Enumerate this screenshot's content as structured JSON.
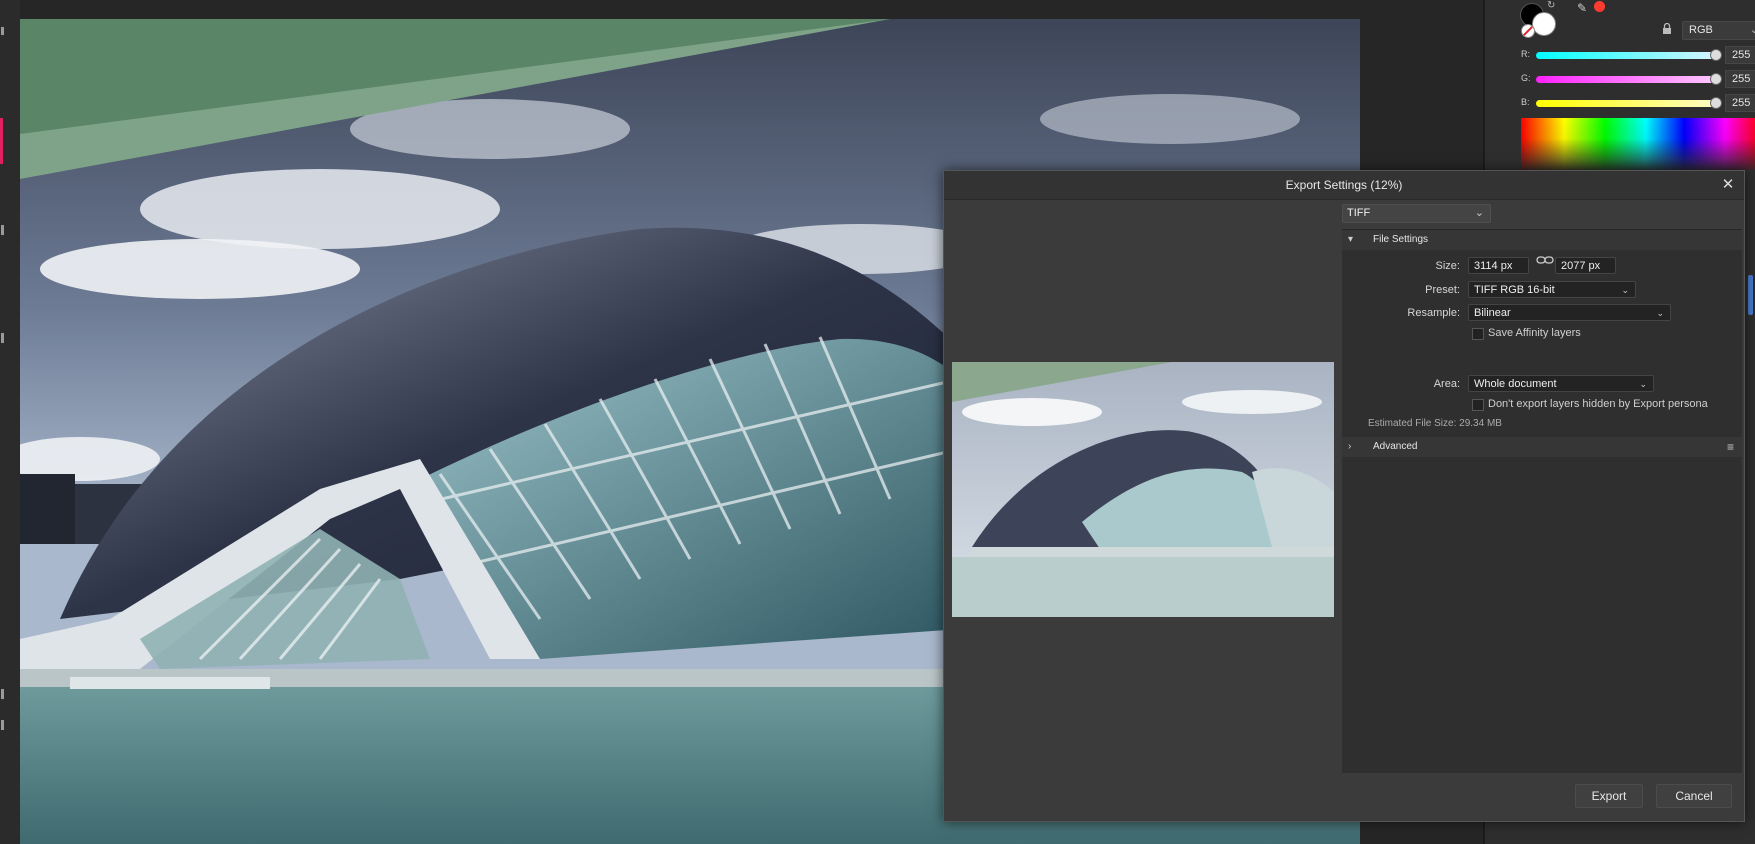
{
  "dialog": {
    "title": "Export Settings (12%)",
    "close_icon": "close-icon",
    "format": "TIFF",
    "sections": {
      "file_settings": "File Settings",
      "advanced": "Advanced"
    },
    "fields": {
      "size_label": "Size:",
      "width": "3114 px",
      "height": "2077 px",
      "preset_label": "Preset:",
      "preset": "TIFF RGB 16-bit",
      "resample_label": "Resample:",
      "resample": "Bilinear",
      "save_affinity_layers": "Save Affinity layers",
      "area_label": "Area:",
      "area": "Whole document",
      "dont_export_hidden": "Don't export layers hidden by Export persona",
      "estimated_size": "Estimated File Size: 29.34 MB"
    },
    "buttons": {
      "export": "Export",
      "cancel": "Cancel"
    }
  },
  "color_panel": {
    "model": "RGB",
    "channels": [
      {
        "label": "R:",
        "value": "255"
      },
      {
        "label": "G:",
        "value": "255"
      },
      {
        "label": "B:",
        "value": "255"
      }
    ],
    "colors": {
      "foreground": "#000000",
      "background": "#ffffff",
      "picker_dot": "#ff3b30"
    }
  },
  "icons": {
    "collapse_arrow": "▾",
    "expand_arrow": "›",
    "chevron": "⌄",
    "link": "⛓",
    "menu": "≡",
    "close": "✕",
    "swap": "↻",
    "picker": "✎",
    "lock": "🔒"
  }
}
